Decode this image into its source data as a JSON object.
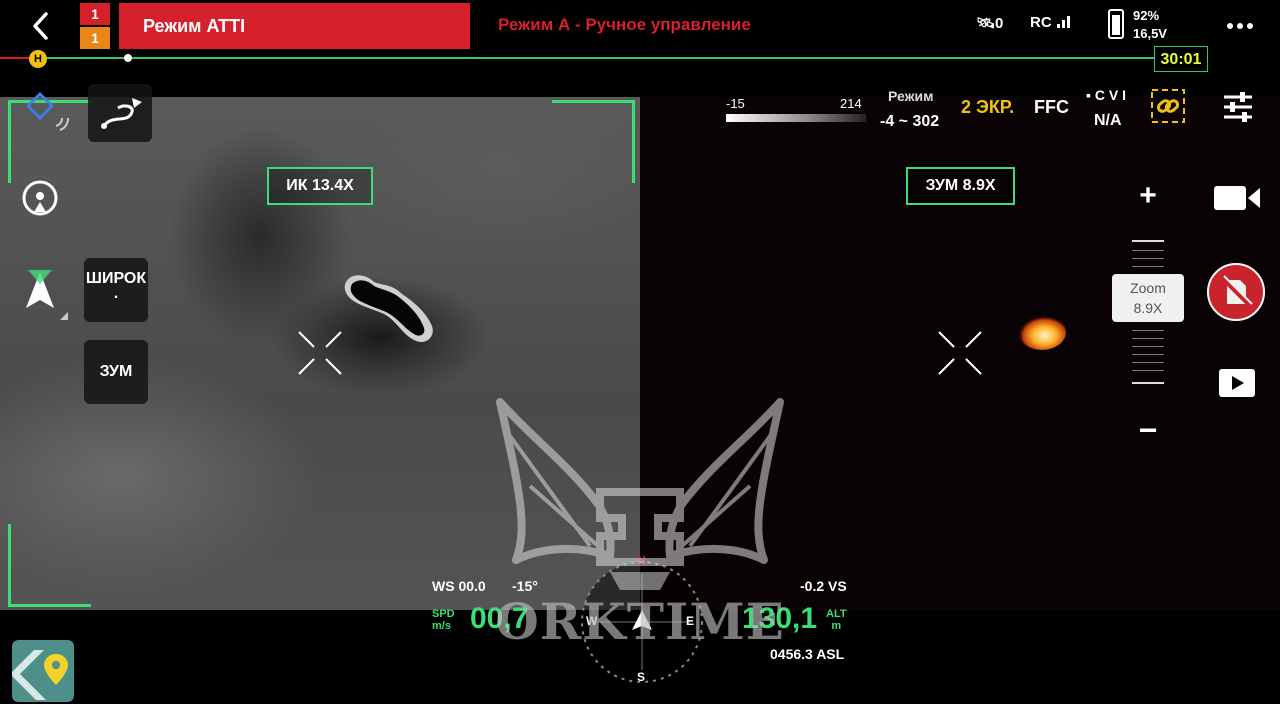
{
  "topbar": {
    "badge_top": "1",
    "badge_bottom": "1",
    "flight_mode": "Режим ATTI",
    "control_mode": "Режим А - Ручное управление",
    "gps_count": "0",
    "rc_label": "RC",
    "battery_percent": "92%",
    "battery_voltage": "16,5V",
    "battery_level": 0.92
  },
  "timeline": {
    "home_marker": "H",
    "timer": "30:01"
  },
  "ir_view": {
    "zoom_label": "ИК 13.4X"
  },
  "zoom_view": {
    "zoom_label": "ЗУМ 8.9X"
  },
  "left_tools": {
    "wide_label": "ШИРОК",
    "wide_sub": ".",
    "zoom_label": "ЗУМ"
  },
  "thermal_status": {
    "scale_min": "-15",
    "scale_max": "214",
    "mode_label": "Режим",
    "mode_range": "-4 ~ 302",
    "screen_mode": "2 ЭКР.",
    "ffc": "FFC",
    "cvi_label": "C V I",
    "cvi_value": "N/A"
  },
  "right_panel": {
    "zoom_in": "+",
    "zoom_out": "−",
    "zoom_chip_label": "Zoom",
    "zoom_chip_value": "8.9X"
  },
  "hud": {
    "ws": "WS 00.0",
    "pitch": "-15°",
    "vs": "-0.2 VS",
    "spd_label": "SPD",
    "spd_unit": "m/s",
    "speed": "00,7",
    "alt": "130,1",
    "alt_label": "ALT",
    "alt_unit": "m",
    "asl": "0456.3 ASL",
    "compass_top": "N",
    "compass_left": "W",
    "compass_right": "E",
    "compass_bottom": "S"
  },
  "watermark": {
    "text": "ORKTIME"
  },
  "colors": {
    "accent_green": "#3ddc77",
    "mode_red": "#d6202b",
    "timer_yellow": "#e8ff3a",
    "screen_yellow": "#f2c10f"
  }
}
